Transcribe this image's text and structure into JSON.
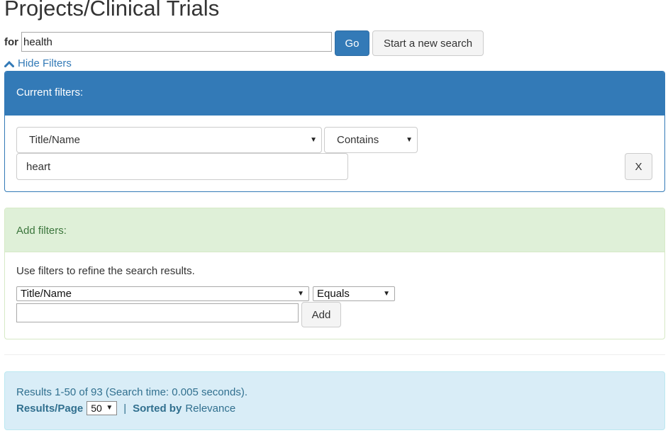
{
  "header": {
    "title": "Projects/Clinical Trials"
  },
  "search": {
    "for_label": "for",
    "query": "health",
    "go_label": "Go",
    "new_search_label": "Start a new search"
  },
  "filters_toggle": {
    "label": "Hide Filters",
    "icon": "chevron-up-icon"
  },
  "current_filters": {
    "heading": "Current filters:",
    "field": "Title/Name",
    "operator": "Contains",
    "value": "heart",
    "remove_label": "X"
  },
  "add_filters": {
    "heading": "Add filters:",
    "help_text": "Use filters to refine the search results.",
    "field": "Title/Name",
    "operator": "Equals",
    "value": "",
    "add_label": "Add"
  },
  "results": {
    "summary": "Results 1-50 of 93 (Search time: 0.005 seconds).",
    "per_page_label": "Results/Page",
    "per_page_value": "50",
    "separator": "|",
    "sorted_by_label": "Sorted by",
    "sorted_by_value": "Relevance"
  },
  "colors": {
    "primary": "#337ab7",
    "success_bg": "#dff0d8",
    "success_text": "#3c763d",
    "info_bg": "#d9edf7",
    "info_text": "#31708f"
  }
}
